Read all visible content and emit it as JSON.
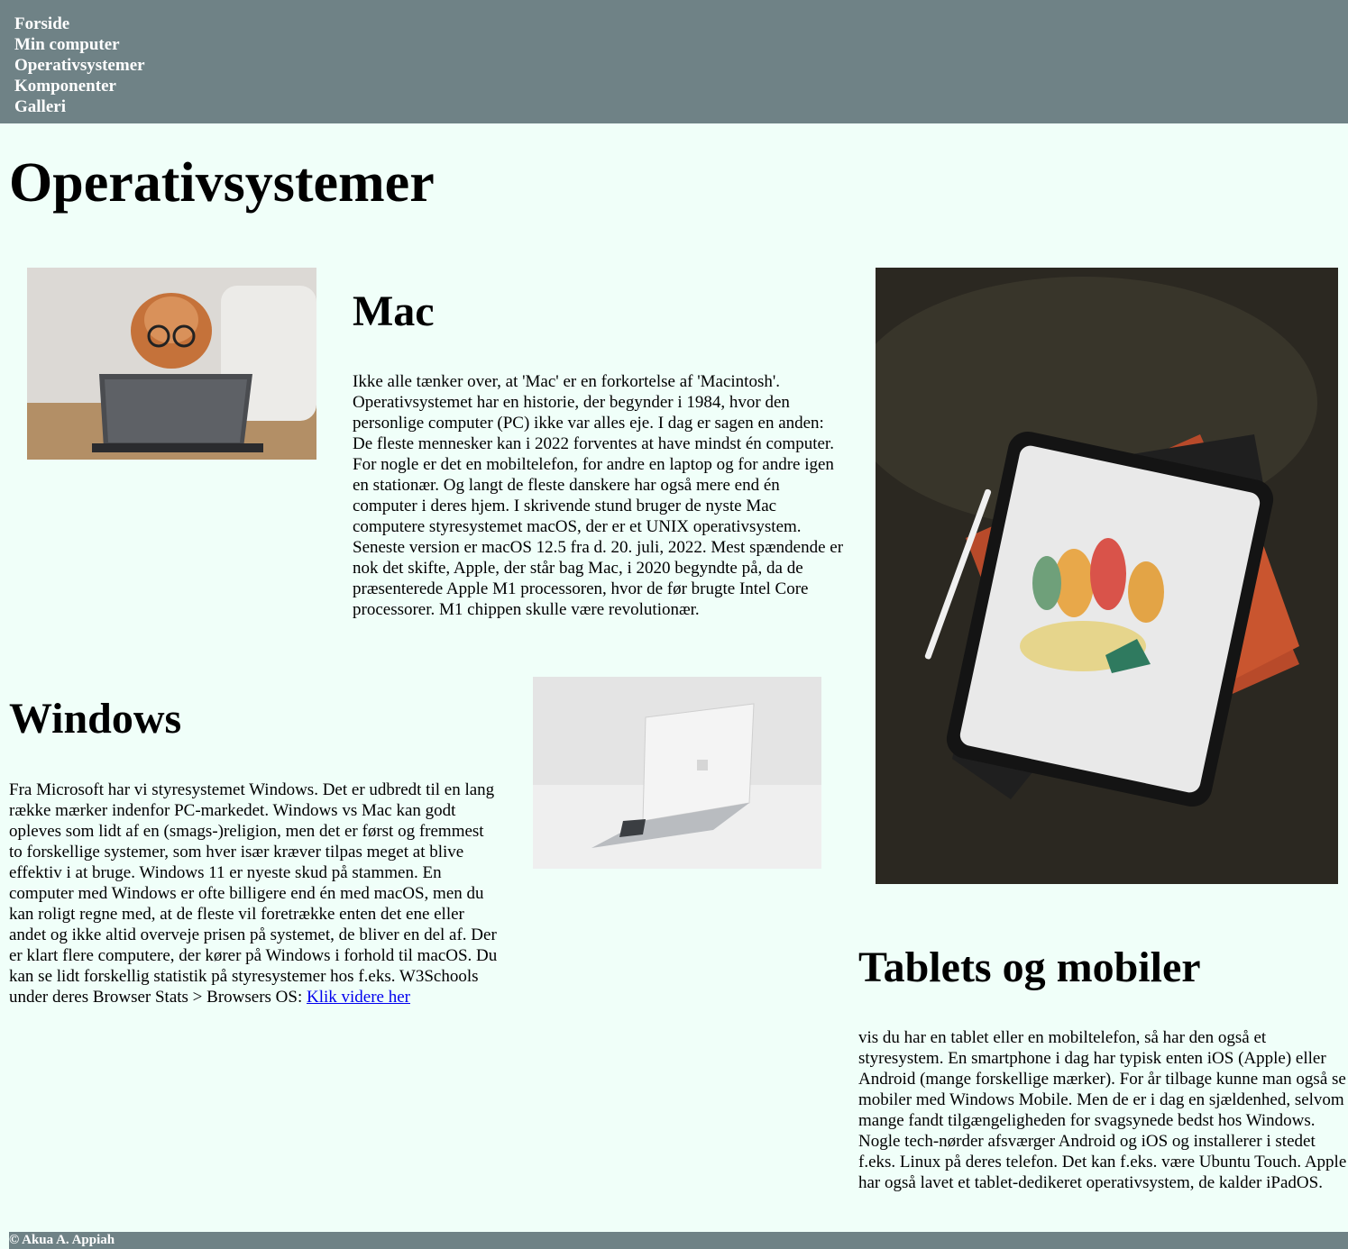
{
  "nav": {
    "items": [
      "Forside",
      "Min computer",
      "Operativsystemer",
      "Komponenter",
      "Galleri"
    ]
  },
  "page_title": "Operativsystemer",
  "sections": {
    "mac": {
      "title": "Mac",
      "text": "Ikke alle tænker over, at 'Mac' er en forkortelse af 'Macintosh'. Operativsystemet har en historie, der begynder i 1984, hvor den personlige computer (PC) ikke var alles eje. I dag er sagen en anden: De fleste mennesker kan i 2022 forventes at have mindst én computer. For nogle er det en mobiltelefon, for andre en laptop og for andre igen en stationær. Og langt de fleste danskere har også mere end én computer i deres hjem. I skrivende stund bruger de nyste Mac computere styresystemet macOS, der er et UNIX operativsystem. Seneste version er macOS 12.5 fra d. 20. juli, 2022. Mest spændende er nok det skifte, Apple, der står bag Mac, i 2020 begyndte på, da de præsenterede Apple M1 processoren, hvor de før brugte Intel Core processorer. M1 chippen skulle være revolutionær."
    },
    "windows": {
      "title": "Windows",
      "text": "Fra Microsoft har vi styresystemet Windows. Det er udbredt til en lang række mærker indenfor PC-markedet. Windows vs Mac kan godt opleves som lidt af en (smags-)religion, men det er først og fremmest to forskellige systemer, som hver især kræver tilpas meget at blive effektiv i at bruge. Windows 11 er nyeste skud på stammen. En computer med Windows er ofte billigere end én med macOS, men du kan roligt regne med, at de fleste vil foretrække enten det ene eller andet og ikke altid overveje prisen på systemet, de bliver en del af. Der er klart flere computere, der kører på Windows i forhold til macOS. Du kan se lidt forskellig statistik på styresystemer hos f.eks. W3Schools under deres Browser Stats > Browsers OS: ",
      "link_text": "Klik videre her"
    },
    "tablets": {
      "title": "Tablets og mobiler",
      "text": "vis du har en tablet eller en mobiltelefon, så har den også et styresystem. En smartphone i dag har typisk enten iOS (Apple) eller Android (mange forskellige mærker). For år tilbage kunne man også se mobiler med Windows Mobile. Men de er i dag en sjældenhed, selvom mange fandt tilgængeligheden for svagsynede bedst hos Windows. Nogle tech-nørder afsværger Android og iOS og installerer i stedet f.eks. Linux på deres telefon. Det kan f.eks. være Ubuntu Touch. Apple har også lavet et tablet-dedikeret operativsystem, de kalder iPadOS."
    }
  },
  "footer": "© Akua A. Appiah",
  "colors": {
    "nav_bg": "#6f8286",
    "page_bg": "#f0fff9",
    "link": "#0000ee"
  }
}
